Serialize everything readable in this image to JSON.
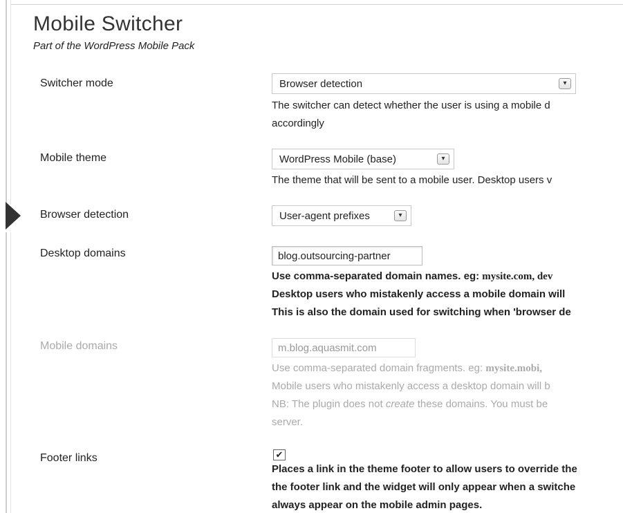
{
  "header": {
    "title": "Mobile Switcher",
    "subtitle": "Part of the WordPress Mobile Pack"
  },
  "fields": {
    "switcher_mode": {
      "label": "Switcher mode",
      "value": "Browser detection",
      "desc": [
        "The switcher can detect whether the user is using a mobile d",
        "accordingly"
      ]
    },
    "mobile_theme": {
      "label": "Mobile theme",
      "value": "WordPress Mobile (base)",
      "desc": [
        "The theme that will be sent to a mobile user. Desktop users v"
      ]
    },
    "browser_detection": {
      "label": "Browser detection",
      "value": "User-agent prefixes"
    },
    "desktop_domains": {
      "label": "Desktop domains",
      "value": "blog.outsourcing-partner",
      "desc_prefix": "Use comma-separated domain names. eg:",
      "desc_example": "mysite.com, dev",
      "desc": [
        "Desktop users who mistakenly access a mobile domain will",
        "This is also the domain used for switching when 'browser de"
      ]
    },
    "mobile_domains": {
      "label": "Mobile domains",
      "value": "m.blog.aquasmit.com",
      "desc_prefix": "Use comma-separated domain fragments. eg:",
      "desc_example": "mysite.mobi,",
      "desc": [
        "Mobile users who mistakenly access a desktop domain will b"
      ],
      "note_prefix": "NB: The plugin does not",
      "note_emphasis": "create",
      "note_suffix": "these domains. You must be",
      "note_tail": "server."
    },
    "footer_links": {
      "label": "Footer links",
      "checked": true,
      "check_glyph": "✔",
      "desc": [
        "Places a link in the theme footer to allow users to override the",
        "the footer link and the widget will only appear when a switche",
        "always appear on the mobile admin pages."
      ]
    }
  },
  "icons": {
    "dropdown": "chevron-down-icon",
    "checkbox": "checkmark-icon",
    "chevron_glyph": "▾"
  }
}
